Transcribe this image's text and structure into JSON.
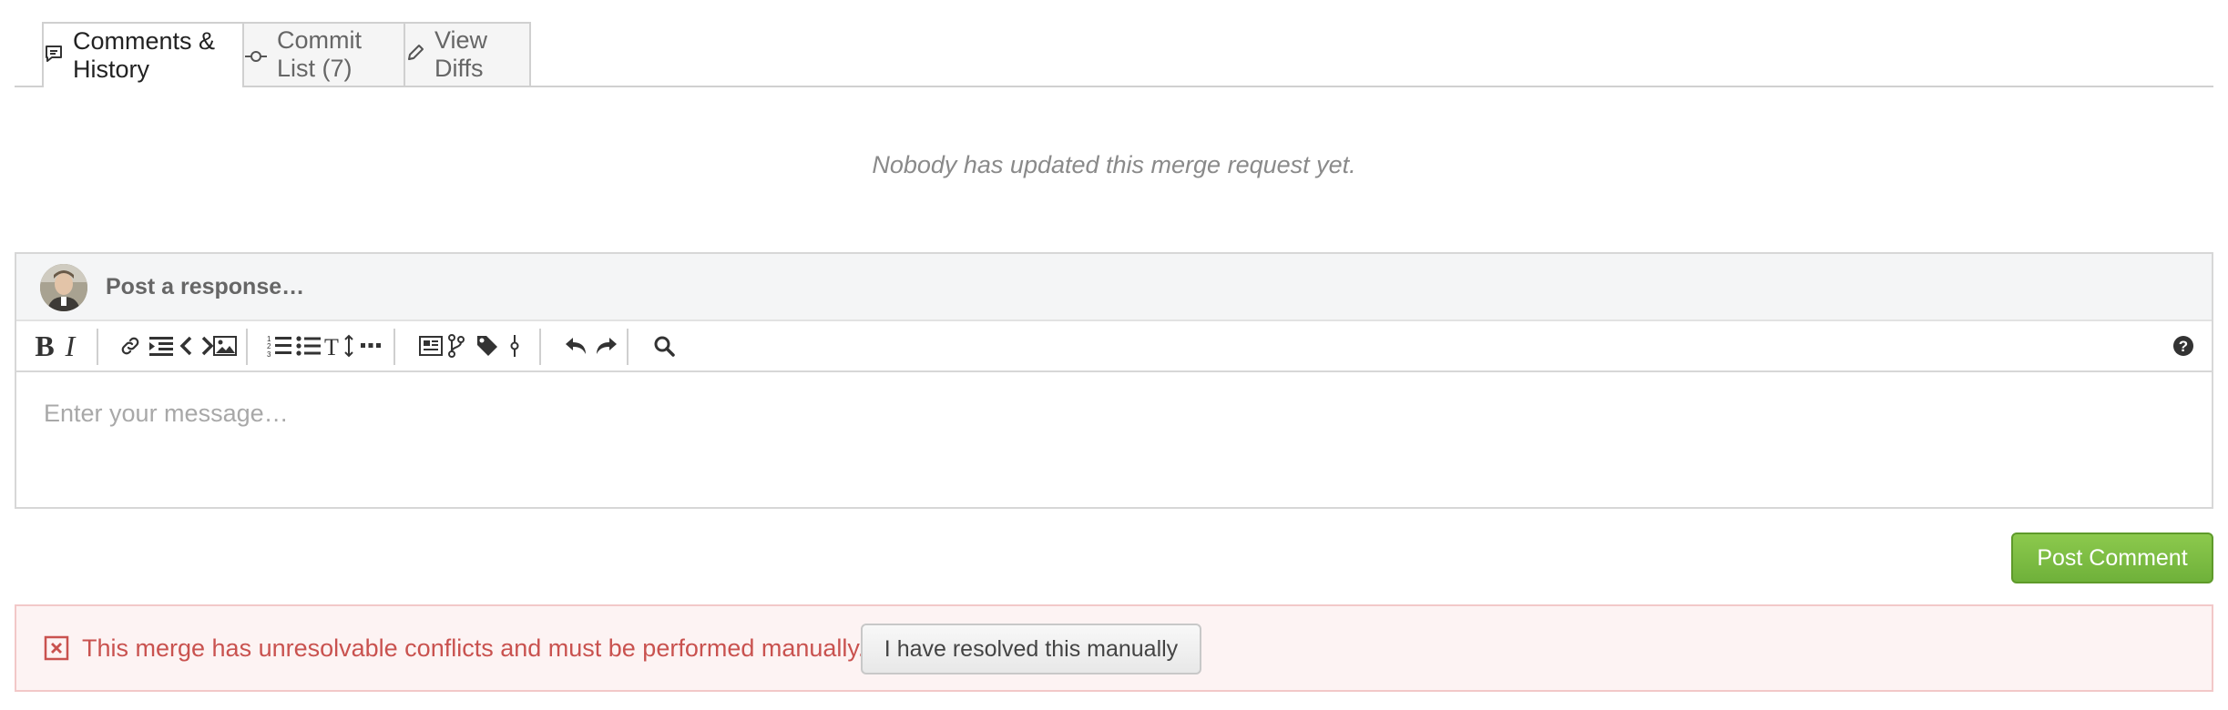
{
  "tabs": [
    {
      "label": "Comments & History",
      "icon": "comment-icon",
      "active": true
    },
    {
      "label": "Commit List (7)",
      "icon": "commit-icon",
      "active": false
    },
    {
      "label": "View Diffs",
      "icon": "pencil-icon",
      "active": false
    }
  ],
  "history": {
    "empty_message": "Nobody has updated this merge request yet."
  },
  "composer": {
    "prompt": "Post a response…",
    "placeholder": "Enter your message…",
    "toolbar": [
      "bold",
      "italic",
      "link",
      "indent",
      "code",
      "image",
      "ordered-list",
      "bullet-list",
      "text-size",
      "more",
      "preview",
      "branch",
      "tag",
      "commit",
      "undo",
      "redo",
      "search",
      "help"
    ]
  },
  "actions": {
    "post_comment": "Post Comment"
  },
  "alert": {
    "message": "This merge has unresolvable conflicts and must be performed manually.",
    "resolve_button": "I have resolved this manually",
    "color": "#c9524f"
  },
  "colors": {
    "accent_green": "#7dbd44",
    "error_red": "#c9524f"
  }
}
